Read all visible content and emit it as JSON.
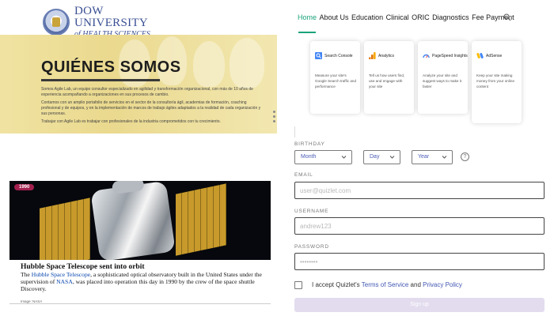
{
  "logo": {
    "title": "DOW UNIVERSITY",
    "subtitle": "of HEALTH SCIENCES",
    "icon": "university-seal-icon"
  },
  "hero": {
    "title": "QUIÉNES SOMOS",
    "paragraph1": "Somos Agile Lab, un equipo consultor especializado en agilidad y transformación organizacional, con más de 10 años de experiencia acompañando a organizaciones en sus procesos de cambio.",
    "paragraph2": "Contamos con un amplio portafolio de servicios en el sector de la consultoría ágil, academias de formación, coaching profesional y de equipos, y en la implementación de marcos de trabajo ágiles adaptados a la realidad de cada organización y sus personas.",
    "paragraph3": "Trabajar con Agile Lab es trabajar con profesionales de la industria comprometidos con tu crecimiento."
  },
  "card": {
    "badge": "1990",
    "title": "Hubble Space Telescope sent into orbit",
    "body_before": "The ",
    "body_link1": "Hubble Space Telescope",
    "body_mid": ", a sophisticated optical observatory built in the United States under the supervision of ",
    "body_link2": "NASA",
    "body_after": ", was placed into operation this day in 1990 by the crew of the space shuttle Discovery.",
    "credit": "Image: NASA"
  },
  "nav": {
    "items": [
      "Home",
      "About Us",
      "Education",
      "Clinical",
      "ORIC",
      "Diagnostics",
      "Fee Payment"
    ],
    "search_icon": "search-icon",
    "accent": "#1aa37a"
  },
  "tools": [
    {
      "name": "Search Console",
      "desc": "Measure your site's Google Search traffic and performance",
      "icon": "search-console-icon",
      "color": "#4285f4"
    },
    {
      "name": "Analytics",
      "desc": "Tell us how users find, use and engage with your site",
      "icon": "analytics-icon",
      "color": "#f9ab00"
    },
    {
      "name": "PageSpeed Insights",
      "desc": "Analyze your site and suggest ways to make it faster",
      "icon": "pagespeed-icon",
      "color": "#e8453c"
    },
    {
      "name": "AdSense",
      "desc": "Keep your site making money from your online content",
      "icon": "adsense-icon",
      "color": "#4285f4"
    }
  ],
  "form": {
    "birthday_label": "BIRTHDAY",
    "month": "Month",
    "day": "Day",
    "year": "Year",
    "help": "?",
    "email_label": "EMAIL",
    "email_placeholder": "user@quizlet.com",
    "username_label": "USERNAME",
    "username_placeholder": "andrew123",
    "password_label": "PASSWORD",
    "password_placeholder": "••••••••",
    "terms_prefix": "I accept Quizlet's ",
    "terms_link": "Terms of Service",
    "terms_and": " and ",
    "privacy_link": "Privacy Policy",
    "signup_label": "Sign up",
    "signup_color": "#e3dcee"
  }
}
